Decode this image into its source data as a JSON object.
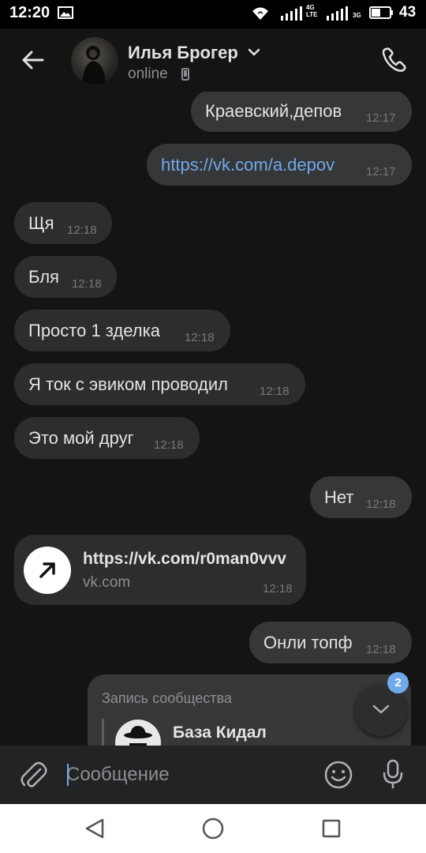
{
  "status_bar": {
    "time": "12:20",
    "net1": "4G\nLTE",
    "net2": "3G",
    "battery": "43"
  },
  "header": {
    "contact_name": "Илья Брогер",
    "status": "online"
  },
  "messages": [
    {
      "dir": "out",
      "text": "Краевский,депов",
      "time": "12:17"
    },
    {
      "dir": "out",
      "text": "https://vk.com/a.depov",
      "time": "12:17",
      "is_link": true
    },
    {
      "dir": "in",
      "text": "Щя",
      "time": "12:18"
    },
    {
      "dir": "in",
      "text": "Бля",
      "time": "12:18"
    },
    {
      "dir": "in",
      "text": "Просто 1 зделка",
      "time": "12:18"
    },
    {
      "dir": "in",
      "text": "Я ток с эвиком проводил",
      "time": "12:18"
    },
    {
      "dir": "in",
      "text": "Это мой друг",
      "time": "12:18"
    },
    {
      "dir": "out",
      "text": "Нет",
      "time": "12:18"
    },
    {
      "dir": "out",
      "text": "Онли топф",
      "time": "12:18"
    }
  ],
  "link_card": {
    "title": "https://vk.com/r0man0vvv",
    "domain": "vk.com",
    "time": "12:18"
  },
  "repost": {
    "label": "Запись сообщества",
    "community_name": "База Кидал"
  },
  "scroll_badge": "2",
  "composer": {
    "placeholder": "Сообщение"
  },
  "colors": {
    "background": "#141414",
    "incoming_bubble": "#2c2d2e",
    "outgoing_bubble": "#363738",
    "link": "#71aaeb",
    "accent": "#71aaeb"
  },
  "icons": [
    "back-arrow-icon",
    "chevron-down-icon",
    "phone-icon",
    "call-icon",
    "external-link-icon",
    "chevron-down-icon",
    "paperclip-icon",
    "smile-icon",
    "mic-icon",
    "nav-back-icon",
    "nav-home-icon",
    "nav-recents-icon"
  ]
}
